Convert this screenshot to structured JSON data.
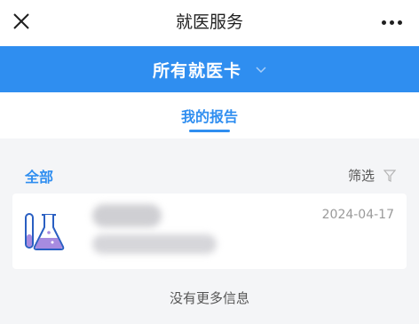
{
  "header": {
    "title": "就医服务",
    "close_icon": "close-icon",
    "more_icon": "more-dots-icon"
  },
  "card_selector": {
    "label": "所有就医卡",
    "chevron_icon": "chevron-down-icon",
    "background": "#2f8ef0"
  },
  "tabs": [
    {
      "label": "我的报告",
      "active": true
    }
  ],
  "filter": {
    "all_label": "全部",
    "filter_label": "筛选",
    "filter_icon": "filter-funnel-icon"
  },
  "reports": [
    {
      "icon": "flask-icon",
      "date": "2024-04-17"
    }
  ],
  "footer_text": "没有更多信息",
  "colors": {
    "accent": "#2f8ef0",
    "page_bg": "#f4f5f7",
    "muted": "#9a9a9a"
  }
}
